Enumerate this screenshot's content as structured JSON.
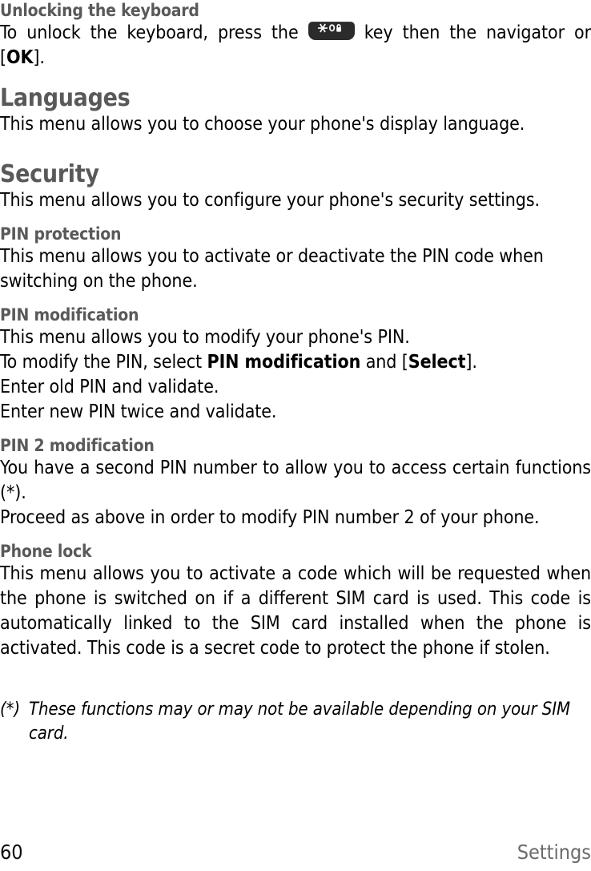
{
  "page": {
    "folio": "60",
    "running_head": "Settings",
    "heading_color": "#595959",
    "body_color": "#000000",
    "key_color": "#2b2b2b"
  },
  "sections": {
    "unlocking": {
      "heading": "Unlocking the keyboard",
      "body_before_key": "To unlock the keyboard, press the",
      "key_icon": "star-lock-key-icon",
      "body_after_key": "key then the navigator or [",
      "bold_ok": "OK",
      "body_tail": "]."
    },
    "languages": {
      "heading": "Languages",
      "body": "This menu allows you to choose your phone's display language."
    },
    "security": {
      "heading": "Security",
      "body": "This menu allows you to configure your phone's security settings."
    },
    "pin_protection": {
      "heading": "PIN protection",
      "body": "This menu allows you to activate or deactivate the PIN code when switching on the phone."
    },
    "pin_modification": {
      "heading": "PIN modification",
      "line1": "This menu allows you to modify your phone's PIN.",
      "line2_a": "To modify the PIN, select ",
      "line2_bold1": "PIN modification",
      "line2_b": " and [",
      "line2_bold2": "Select",
      "line2_c": "].",
      "line3": "Enter old PIN and validate.",
      "line4": "Enter new PIN twice and validate."
    },
    "pin2_modification": {
      "heading": "PIN 2 modification",
      "para1": "You have a second PIN number to allow you to access certain functions (*).",
      "para2": "Proceed as above in order to modify PIN number 2 of your phone."
    },
    "phone_lock": {
      "heading": "Phone lock",
      "body": "This menu allows you to activate a code which will be requested when the phone is switched on if a different SIM card is used. This code is automatically linked to the SIM card installed when the phone is activated. This code is a secret code to protect the phone if stolen."
    },
    "footnote": {
      "marker": "(*)",
      "text": "These functions may or may not be available depending on your SIM card."
    }
  }
}
